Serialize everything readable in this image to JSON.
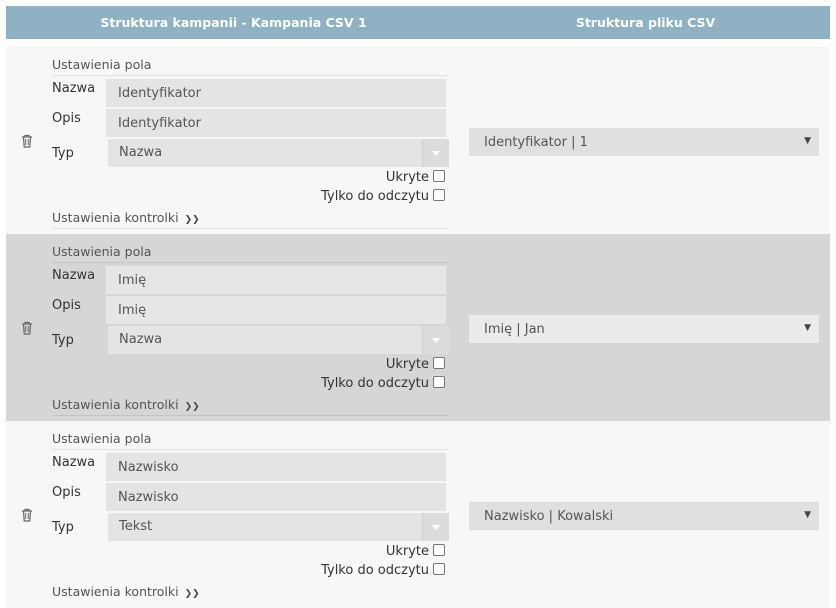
{
  "header": {
    "left_title": "Struktura kampanii - Kampania CSV 1",
    "right_title": "Struktura pliku CSV"
  },
  "labels": {
    "section": "Ustawienia pola",
    "nazwa": "Nazwa",
    "opis": "Opis",
    "typ": "Typ",
    "ukryte": "Ukryte",
    "tylko": "Tylko do odczytu",
    "kontrolki": "Ustawienia kontrolki",
    "chevron": "»"
  },
  "fields": [
    {
      "nazwa": "Identyfikator",
      "opis": "Identyfikator",
      "typ": "Nazwa",
      "csv": "Identyfikator | 1"
    },
    {
      "nazwa": "Imię",
      "opis": "Imię",
      "typ": "Nazwa",
      "csv": "Imię | Jan"
    },
    {
      "nazwa": "Nazwisko",
      "opis": "Nazwisko",
      "typ": "Tekst",
      "csv": "Nazwisko | Kowalski"
    }
  ],
  "icons": {
    "delete": "trash-icon",
    "dropdown": "chevron-down-icon",
    "expand": "double-chevron-down-icon"
  },
  "colors": {
    "header_bg": "#8eb1c3",
    "row_bg": "#f7f7f7",
    "row_alt_bg": "#d6d6d6",
    "input_bg": "#e4e4e4"
  }
}
